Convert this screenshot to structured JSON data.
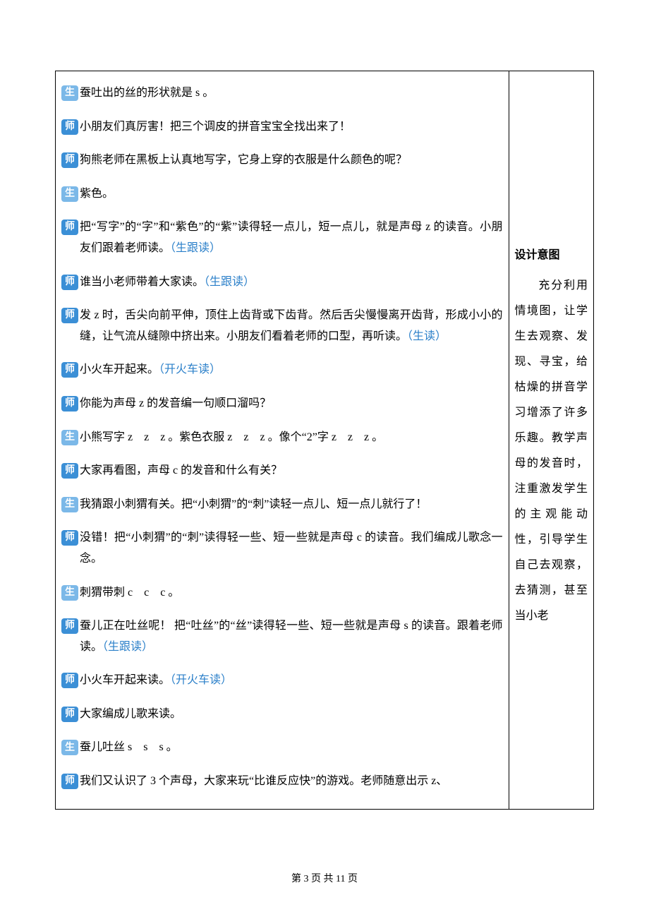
{
  "footer": {
    "text": "第 3 页 共 11 页"
  },
  "badges": {
    "shi": "师",
    "sheng": "生"
  },
  "lines": [
    {
      "role": "sheng",
      "parts": [
        {
          "t": "蚕吐出的丝的形状就是 s 。"
        }
      ]
    },
    {
      "role": "shi",
      "parts": [
        {
          "t": "小朋友们真厉害！把三个调皮的拼音宝宝全找出来了！"
        }
      ]
    },
    {
      "role": "shi",
      "parts": [
        {
          "t": "狗熊老师在黑板上认真地写字，它身上穿的衣服是什么颜色的呢？"
        }
      ]
    },
    {
      "role": "sheng",
      "parts": [
        {
          "t": "紫色。"
        }
      ]
    },
    {
      "role": "shi",
      "parts": [
        {
          "t": "把“写字”的“字”和“紫色”的“紫”读得轻一点儿，短一点儿，就是声母 z 的读音。小朋友们跟着老师读。"
        },
        {
          "t": "（生跟读）",
          "c": "blue"
        }
      ]
    },
    {
      "role": "shi",
      "parts": [
        {
          "t": "谁当小老师带着大家读。"
        },
        {
          "t": "（生跟读）",
          "c": "blue"
        }
      ]
    },
    {
      "role": "shi",
      "parts": [
        {
          "t": "发 z 时，舌尖向前平伸，顶住上齿背或下齿背。然后舌尖慢慢离开齿背，形成小小的缝，让气流从缝隙中挤出来。小朋友们看着老师的口型，再听读。"
        },
        {
          "t": "（生读）",
          "c": "blue"
        }
      ]
    },
    {
      "role": "shi",
      "parts": [
        {
          "t": "小火车开起来。"
        },
        {
          "t": "（开火车读）",
          "c": "blue"
        }
      ]
    },
    {
      "role": "shi",
      "parts": [
        {
          "t": "你能为声母 z 的发音编一句顺口溜吗？"
        }
      ]
    },
    {
      "role": "sheng",
      "parts": [
        {
          "t": "小熊写字 z　z　z 。紫色衣服 z　z　z 。像个“2”字 z　z　z 。"
        }
      ]
    },
    {
      "role": "shi",
      "parts": [
        {
          "t": "大家再看图，声母 c 的发音和什么有关？"
        }
      ]
    },
    {
      "role": "sheng",
      "parts": [
        {
          "t": "我猜跟小刺猬有关。把“小刺猬”的“刺”读轻一点儿、短一点儿就行了！"
        }
      ]
    },
    {
      "role": "shi",
      "parts": [
        {
          "t": "没错！把“小刺猬”的“刺”读得轻一些、短一些就是声母 c 的读音。我们编成儿歌念一念。"
        }
      ]
    },
    {
      "role": "sheng",
      "parts": [
        {
          "t": "刺猬带刺 c　c　c 。"
        }
      ]
    },
    {
      "role": "shi",
      "parts": [
        {
          "t": "蚕儿正在吐丝呢！ 把“吐丝”的“丝”读得轻一些、短一些就是声母 s 的读音。跟着老师读。"
        },
        {
          "t": "（生跟读）",
          "c": "blue"
        }
      ]
    },
    {
      "role": "shi",
      "parts": [
        {
          "t": "小火车开起来读。"
        },
        {
          "t": "（开火车读）",
          "c": "blue"
        }
      ]
    },
    {
      "role": "shi",
      "parts": [
        {
          "t": "大家编成儿歌来读。"
        }
      ]
    },
    {
      "role": "sheng",
      "parts": [
        {
          "t": "蚕儿吐丝 s　s　s 。"
        }
      ]
    },
    {
      "role": "shi",
      "parts": [
        {
          "t": "我们又认识了 3 个声母，大家来玩“比谁反应快”的游戏。老师随意出示 z、"
        }
      ]
    }
  ],
  "right": {
    "heading": "设计意图",
    "body": "充分利用情境图，让学生去观察、发现、寻宝，给枯燥的拼音学习增添了许多乐趣。教学声母的发音时，注重激发学生的主观能动性，引导学生自己去观察，去猜测，甚至当小老"
  }
}
